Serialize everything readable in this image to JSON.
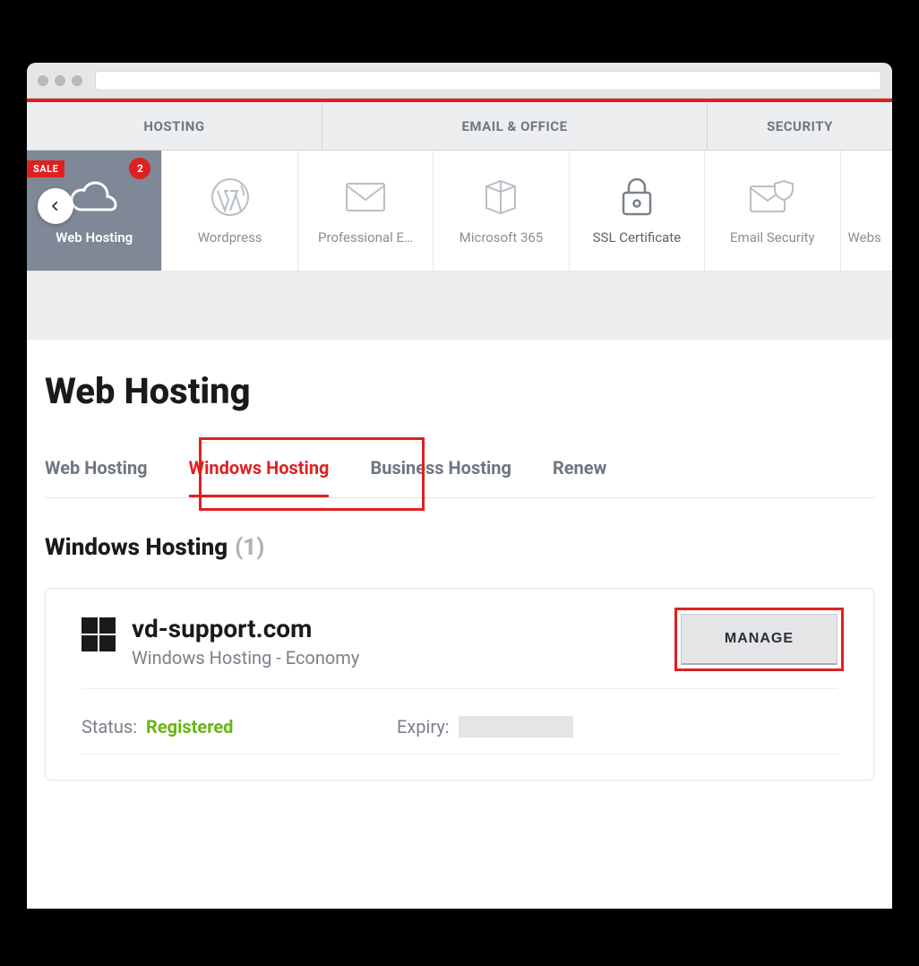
{
  "categories": {
    "hosting": "HOSTING",
    "email_office": "EMAIL & OFFICE",
    "security": "SECURITY"
  },
  "products": {
    "sale_badge": "SALE",
    "count_badge": "2",
    "web_hosting": "Web Hosting",
    "wordpress": "Wordpress",
    "professional_email": "Professional E…",
    "microsoft_365": "Microsoft 365",
    "ssl_certificate": "SSL Certificate",
    "email_security": "Email Security",
    "website_security_partial": "Webs"
  },
  "page_title": "Web Hosting",
  "tabs": {
    "web_hosting": "Web Hosting",
    "windows_hosting": "Windows Hosting",
    "business_hosting": "Business Hosting",
    "renew": "Renew"
  },
  "section": {
    "title": "Windows Hosting",
    "count": "(1)"
  },
  "card": {
    "domain": "vd-support.com",
    "plan": "Windows Hosting - Economy",
    "manage_label": "MANAGE",
    "status_label": "Status:",
    "status_value": "Registered",
    "expiry_label": "Expiry:"
  },
  "highlights": {
    "windows_tab": true,
    "manage_button": true
  }
}
